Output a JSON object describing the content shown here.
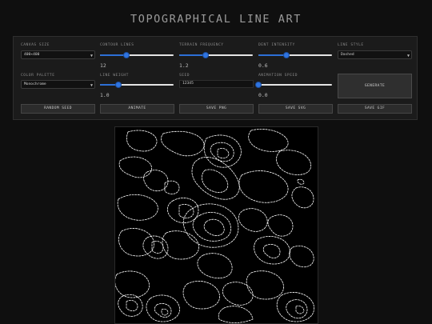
{
  "app": {
    "title": "TOPOGRAPHICAL LINE ART"
  },
  "controls": {
    "canvas_size": {
      "label": "CANVAS SIZE",
      "value": "400×400"
    },
    "contour_lines": {
      "label": "CONTOUR LINES",
      "value": "12",
      "fraction": 0.36
    },
    "terrain_frequency": {
      "label": "TERRAIN FREQUENCY",
      "value": "1.2",
      "fraction": 0.36
    },
    "dent_intensity": {
      "label": "DENT INTENSITY",
      "value": "0.6",
      "fraction": 0.38
    },
    "line_style": {
      "label": "LINE STYLE",
      "value": "Dashed"
    },
    "color_palette": {
      "label": "COLOR PALETTE",
      "value": "Monochrome"
    },
    "line_weight": {
      "label": "LINE WEIGHT",
      "value": "1.0",
      "fraction": 0.25
    },
    "seed": {
      "label": "SEED",
      "value": "12345"
    },
    "animation_speed": {
      "label": "ANIMATION SPEED",
      "value": "0.0",
      "fraction": 0.0
    }
  },
  "buttons": {
    "generate": "GENERATE",
    "random_seed": "RANDOM SEED",
    "animate": "ANIMATE",
    "save_png": "SAVE PNG",
    "save_svg": "SAVE SVG",
    "save_gif": "SAVE GIF"
  },
  "colors": {
    "accent": "#2f74e0",
    "background": "#0f0f0f",
    "panel": "#1b1b1b",
    "contour_line": "#ffffff"
  },
  "icons": {
    "select_caret": "chevron-down-icon"
  }
}
